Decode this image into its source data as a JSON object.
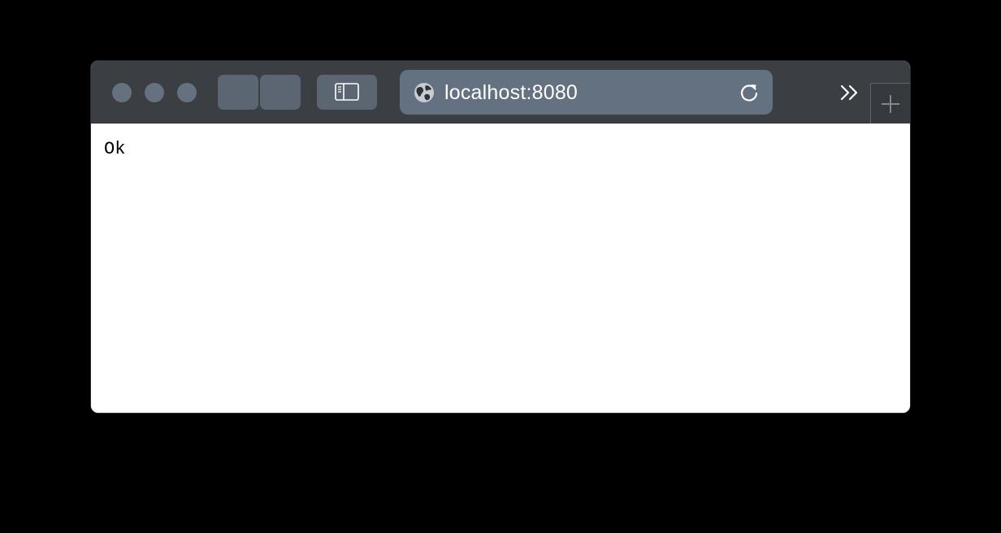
{
  "address_bar": {
    "url": "localhost:8080"
  },
  "page": {
    "body_text": "Ok"
  },
  "icons": {
    "globe": "globe-icon",
    "reload": "reload-icon",
    "sidebar": "sidebar-icon",
    "overflow": "chevrons-right-icon",
    "new_tab": "plus-icon"
  },
  "colors": {
    "toolbar_bg": "#3b3e43",
    "control_bg": "#5b6672",
    "address_bg": "#647180",
    "traffic_light": "#65717e",
    "page_bg": "#ffffff"
  }
}
